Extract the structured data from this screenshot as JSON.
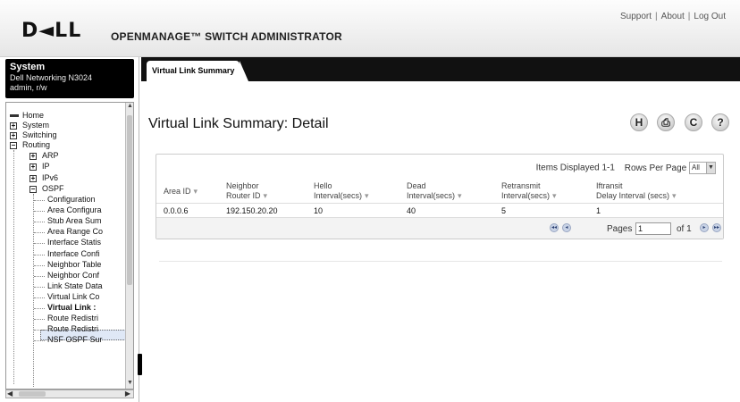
{
  "header": {
    "logo": "D◄LL",
    "product": "OPENMANAGE™ SWITCH ADMINISTRATOR",
    "links": [
      "Support",
      "About",
      "Log Out"
    ]
  },
  "sidebar": {
    "system_title": "System",
    "device": "Dell Networking N3024",
    "user": "admin, r/w",
    "tree": {
      "home": "Home",
      "system": "System",
      "switching": "Switching",
      "routing": "Routing",
      "arp": "ARP",
      "ip": "IP",
      "ipv6": "IPv6",
      "ospf": "OSPF",
      "ospf_items": [
        "Configuration",
        "Area Configura",
        "Stub Area Sum",
        "Area Range Co",
        "Interface Statis",
        "Interface Confi",
        "Neighbor Table",
        "Neighbor Conf",
        "Link State Data",
        "Virtual Link Co",
        "Virtual Link :",
        "Route Redistri",
        "Route Redistri",
        "NSF OSPF Sur"
      ]
    }
  },
  "tab": {
    "label": "Virtual Link Summary"
  },
  "page": {
    "title": "Virtual Link Summary: Detail"
  },
  "toolbar": {
    "save": "H",
    "print": "⎙",
    "refresh": "C",
    "help": "?"
  },
  "table": {
    "items_displayed": "Items Displayed 1-1",
    "rows_per_page_label": "Rows Per Page",
    "rows_per_page_value": "All",
    "columns": [
      [
        "Area ID"
      ],
      [
        "Neighbor",
        "Router ID"
      ],
      [
        "Hello",
        "Interval(secs)"
      ],
      [
        "Dead",
        "Interval(secs)"
      ],
      [
        "Retransmit",
        "Interval(secs)"
      ],
      [
        "Iftransit",
        "Delay Interval (secs)"
      ]
    ],
    "rows": [
      [
        "0.0.0.6",
        "192.150.20.20",
        "10",
        "40",
        "5",
        "1"
      ]
    ],
    "pages_label": "Pages",
    "page_value": "1",
    "of_label": "of 1"
  }
}
